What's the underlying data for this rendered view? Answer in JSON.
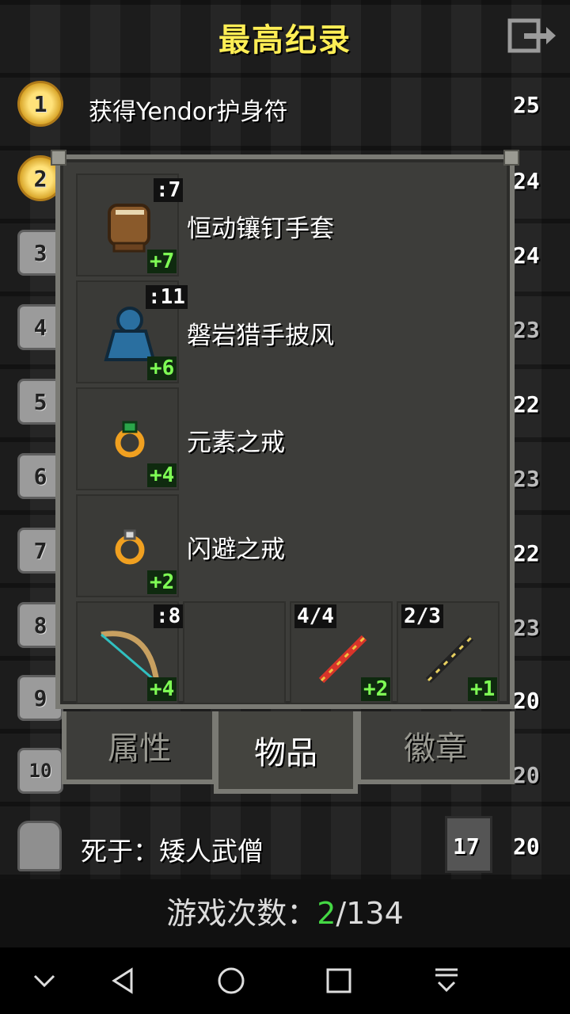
{
  "header": {
    "title": "最高纪录",
    "exit_icon": "exit-icon"
  },
  "records": [
    {
      "rank": "1",
      "text": "获得Yendor护身符",
      "score": "25"
    },
    {
      "rank": "2",
      "score": "24"
    },
    {
      "rank": "3",
      "score": "24"
    },
    {
      "rank": "4",
      "score": "23"
    },
    {
      "rank": "5",
      "score": "22"
    },
    {
      "rank": "6",
      "score": "23"
    },
    {
      "rank": "7",
      "score": "22"
    },
    {
      "rank": "8",
      "score": "23"
    },
    {
      "rank": "9",
      "score": "20"
    },
    {
      "rank": "10",
      "score": "20"
    }
  ],
  "panel": {
    "items": [
      {
        "name": "恒动镶钉手套",
        "qty": ":7",
        "upgrade": "+7",
        "icon": "gauntlet-icon"
      },
      {
        "name": "磐岩猎手披风",
        "qty": ":11",
        "upgrade": "+6",
        "icon": "cloak-icon"
      },
      {
        "name": "元素之戒",
        "upgrade": "+4",
        "icon": "ring-icon"
      },
      {
        "name": "闪避之戒",
        "upgrade": "+2",
        "icon": "ring-icon"
      }
    ],
    "quickslots": [
      {
        "icon": "bow-icon",
        "qty": ":8",
        "upgrade": "+4"
      },
      {
        "icon": "empty-slot"
      },
      {
        "icon": "wand-icon",
        "qty": "4/4",
        "upgrade": "+2"
      },
      {
        "icon": "wand-icon",
        "qty": "2/3",
        "upgrade": "+1"
      }
    ]
  },
  "tabs": {
    "stats": "属性",
    "items": "物品",
    "badges": "徽章"
  },
  "last_entry": {
    "text": "死于：矮人武僧",
    "level": "17",
    "score": "20"
  },
  "games": {
    "label": "游戏次数：",
    "current": "2",
    "total": "/134"
  },
  "colors": {
    "title": "#ffee55",
    "upgrade": "#7fff55",
    "current_games": "#44d844"
  }
}
